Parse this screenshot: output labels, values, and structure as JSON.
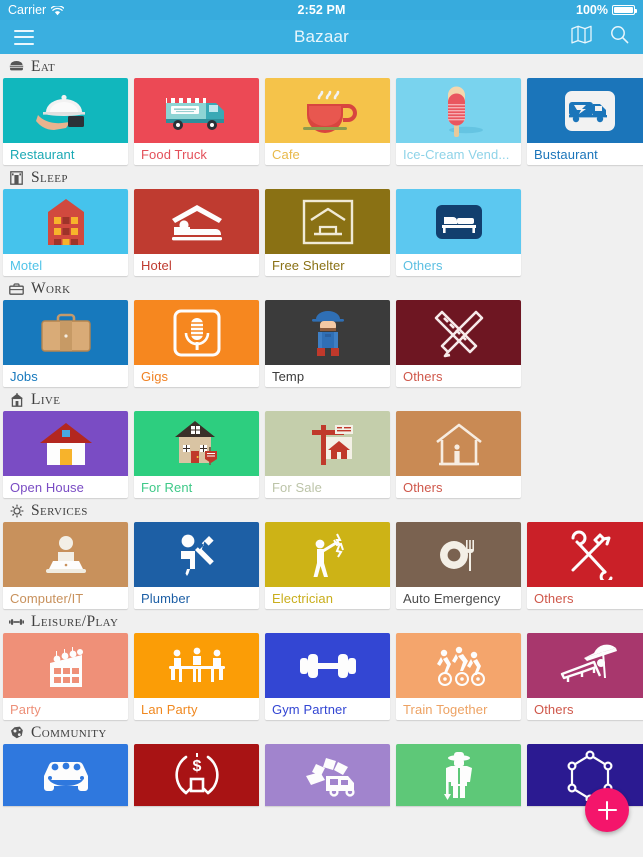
{
  "status_bar": {
    "carrier": "Carrier",
    "wifi_icon": "wifi-icon",
    "time": "2:52 PM",
    "battery_percent": "100%",
    "battery_icon": "battery-full-icon"
  },
  "nav_bar": {
    "menu_icon": "hamburger-menu-icon",
    "title": "Bazaar",
    "map_icon": "map-icon",
    "search_icon": "search-icon",
    "background_color": "#3aafe0"
  },
  "fab": {
    "icon": "plus-icon",
    "color": "#f4156b",
    "label": "add"
  },
  "sections": [
    {
      "id": "eat",
      "title": "Eat",
      "icon": "burger-icon",
      "cards": [
        {
          "label": "Restaurant",
          "bg": "#11b7bd",
          "text_color": "#1aa9b4",
          "icon": "cloche-serving-tray-icon"
        },
        {
          "label": "Food Truck",
          "bg": "#ec4955",
          "text_color": "#e3505a",
          "icon": "food-truck-icon"
        },
        {
          "label": "Cafe",
          "bg": "#f5c34a",
          "text_color": "#e8b94a",
          "icon": "coffee-cup-icon"
        },
        {
          "label": "Ice-Cream Vend...",
          "bg": "#79d3ee",
          "text_color": "#8ed3e8",
          "icon": "ice-cream-bar-icon"
        },
        {
          "label": "Bustaurant",
          "bg": "#1b75ba",
          "text_color": "#1b75ba",
          "icon": "bus-restaurant-icon"
        }
      ]
    },
    {
      "id": "sleep",
      "title": "Sleep",
      "icon": "building-icon",
      "cards": [
        {
          "label": "Motel",
          "bg": "#45c3ec",
          "text_color": "#4fc3e8",
          "icon": "motel-building-icon"
        },
        {
          "label": "Hotel",
          "bg": "#bf3b30",
          "text_color": "#bf3b30",
          "icon": "hotel-bed-icon"
        },
        {
          "label": "Free Shelter",
          "bg": "#8a7114",
          "text_color": "#8a7114",
          "icon": "shelter-icon"
        },
        {
          "label": "Others",
          "bg": "#5cc8f0",
          "text_color": "#5bbfe2",
          "icon": "bed-icon"
        }
      ]
    },
    {
      "id": "work",
      "title": "Work",
      "icon": "briefcase-icon",
      "cards": [
        {
          "label": "Jobs",
          "bg": "#1779bd",
          "text_color": "#1779bd",
          "icon": "briefcase-large-icon"
        },
        {
          "label": "Gigs",
          "bg": "#f6871f",
          "text_color": "#f08122",
          "icon": "microphone-icon"
        },
        {
          "label": "Temp",
          "bg": "#3b3b3b",
          "text_color": "#3b3b3b",
          "icon": "worker-character-icon"
        },
        {
          "label": "Others",
          "bg": "#6e1622",
          "text_color": "#cf574a",
          "icon": "ruler-pencil-icon"
        }
      ]
    },
    {
      "id": "live",
      "title": "Live",
      "icon": "house-icon",
      "cards": [
        {
          "label": "Open House",
          "bg": "#7a4cc4",
          "text_color": "#7a4cc4",
          "icon": "open-house-icon"
        },
        {
          "label": "For Rent",
          "bg": "#2dce7f",
          "text_color": "#3ec988",
          "icon": "for-rent-house-icon"
        },
        {
          "label": "For Sale",
          "bg": "#c4ceab",
          "text_color": "#bcc4a8",
          "icon": "for-sale-sign-icon"
        },
        {
          "label": "Others",
          "bg": "#c98a54",
          "text_color": "#cf574a",
          "icon": "house-outline-person-icon"
        }
      ]
    },
    {
      "id": "services",
      "title": "Services",
      "icon": "gear-icon",
      "cards": [
        {
          "label": "Computer/IT",
          "bg": "#c8915c",
          "text_color": "#c8915c",
          "icon": "laptop-person-icon"
        },
        {
          "label": "Plumber",
          "bg": "#1d5fa5",
          "text_color": "#1d5fa5",
          "icon": "plumber-wrench-icon"
        },
        {
          "label": "Electrician",
          "bg": "#cdb316",
          "text_color": "#c9ae1c",
          "icon": "electrician-icon"
        },
        {
          "label": "Auto Emergency",
          "bg": "#7a6250",
          "text_color": "#4a4a4a",
          "icon": "plate-fork-icon"
        },
        {
          "label": "Others",
          "bg": "#ca2028",
          "text_color": "#cf574a",
          "icon": "hammer-wrench-icon"
        }
      ]
    },
    {
      "id": "leisure",
      "title": "Leisure/Play",
      "icon": "dumbbell-icon",
      "cards": [
        {
          "label": "Party",
          "bg": "#ef9078",
          "text_color": "#ed9079",
          "icon": "party-building-icon"
        },
        {
          "label": "Lan Party",
          "bg": "#fb9d06",
          "text_color": "#f0881f",
          "icon": "lan-party-table-icon"
        },
        {
          "label": "Gym Partner",
          "bg": "#3346d3",
          "text_color": "#3346d3",
          "icon": "dumbbell-large-icon"
        },
        {
          "label": "Train Together",
          "bg": "#f4a56c",
          "text_color": "#eda263",
          "icon": "cyclists-icon"
        },
        {
          "label": "Others",
          "bg": "#a8376d",
          "text_color": "#cf574a",
          "icon": "beach-lounger-icon"
        }
      ]
    },
    {
      "id": "community",
      "title": "Community",
      "icon": "community-icon",
      "cards": [
        {
          "label": "",
          "bg": "#2f78de",
          "text_color": "#2f78de",
          "icon": "carpool-icon"
        },
        {
          "label": "",
          "bg": "#a81314",
          "text_color": "#a81314",
          "icon": "money-exchange-icon"
        },
        {
          "label": "",
          "bg": "#a184cd",
          "text_color": "#a184cd",
          "icon": "junk-removal-icon"
        },
        {
          "label": "",
          "bg": "#5ec878",
          "text_color": "#5ec878",
          "icon": "farmer-icon"
        },
        {
          "label": "",
          "bg": "#2b1a91",
          "text_color": "#2b1a91",
          "icon": "network-nodes-icon"
        }
      ]
    }
  ]
}
